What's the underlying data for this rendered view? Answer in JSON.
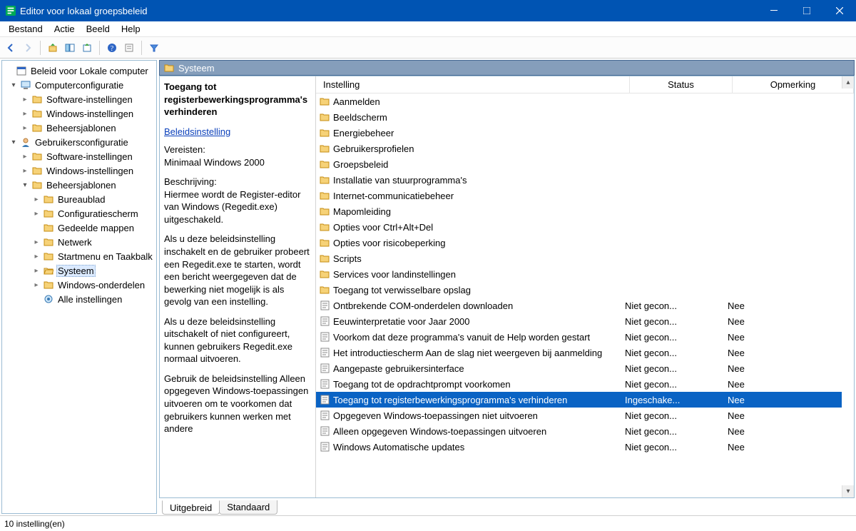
{
  "titlebar": {
    "title": "Editor voor lokaal groepsbeleid"
  },
  "menu": [
    "Bestand",
    "Actie",
    "Beeld",
    "Help"
  ],
  "node_header": "Systeem",
  "tree": {
    "root": "Beleid voor Lokale computer",
    "computer": {
      "label": "Computerconfiguratie",
      "children": [
        "Software-instellingen",
        "Windows-instellingen",
        "Beheersjablonen"
      ]
    },
    "user": {
      "label": "Gebruikersconfiguratie",
      "children": {
        "software": "Software-instellingen",
        "windows": "Windows-instellingen",
        "admin": {
          "label": "Beheersjablonen",
          "children": [
            "Bureaublad",
            "Configuratiescherm",
            "Gedeelde mappen",
            "Netwerk",
            "Startmenu en Taakbalk",
            "Systeem",
            "Windows-onderdelen",
            "Alle instellingen"
          ]
        }
      }
    }
  },
  "desc": {
    "title": "Toegang tot registerbewerkingsprogramma's verhinderen",
    "link": "Beleidsinstelling",
    "req_label": "Vereisten:",
    "req_value": "Minimaal Windows 2000",
    "body_label": "Beschrijving:",
    "body1": "Hiermee wordt de Register-editor van Windows (Regedit.exe) uitgeschakeld.",
    "body2": "Als u deze beleidsinstelling inschakelt en de gebruiker probeert een Regedit.exe te starten, wordt een bericht weergegeven dat de bewerking niet mogelijk is als gevolg van een instelling.",
    "body3": "Als u deze beleidsinstelling uitschakelt of niet configureert, kunnen gebruikers Regedit.exe normaal uitvoeren.",
    "body4": "Gebruik de beleidsinstelling Alleen opgegeven Windows-toepassingen uitvoeren om te voorkomen dat gebruikers kunnen werken met andere"
  },
  "columns": {
    "setting": "Instelling",
    "status": "Status",
    "comment": "Opmerking"
  },
  "list": {
    "folders": [
      "Aanmelden",
      "Beeldscherm",
      "Energiebeheer",
      "Gebruikersprofielen",
      "Groepsbeleid",
      "Installatie van stuurprogramma's",
      "Internet-communicatiebeheer",
      "Mapomleiding",
      "Opties voor Ctrl+Alt+Del",
      "Opties voor risicobeperking",
      "Scripts",
      "Services voor landinstellingen",
      "Toegang tot verwisselbare opslag"
    ],
    "policies": [
      {
        "name": "Ontbrekende COM-onderdelen downloaden",
        "status": "Niet gecon...",
        "comment": "Nee"
      },
      {
        "name": "Eeuwinterpretatie voor Jaar 2000",
        "status": "Niet gecon...",
        "comment": "Nee"
      },
      {
        "name": "Voorkom dat deze programma's vanuit de Help worden gestart",
        "status": "Niet gecon...",
        "comment": "Nee"
      },
      {
        "name": "Het introductiescherm Aan de slag niet weergeven bij aanmelding",
        "status": "Niet gecon...",
        "comment": "Nee"
      },
      {
        "name": "Aangepaste gebruikersinterface",
        "status": "Niet gecon...",
        "comment": "Nee"
      },
      {
        "name": "Toegang tot de opdrachtprompt voorkomen",
        "status": "Niet gecon...",
        "comment": "Nee"
      },
      {
        "name": "Toegang tot registerbewerkingsprogramma's verhinderen",
        "status": "Ingeschake...",
        "comment": "Nee",
        "selected": true
      },
      {
        "name": "Opgegeven Windows-toepassingen niet uitvoeren",
        "status": "Niet gecon...",
        "comment": "Nee"
      },
      {
        "name": "Alleen opgegeven Windows-toepassingen uitvoeren",
        "status": "Niet gecon...",
        "comment": "Nee"
      },
      {
        "name": "Windows Automatische updates",
        "status": "Niet gecon...",
        "comment": "Nee"
      }
    ]
  },
  "tabs": {
    "extended": "Uitgebreid",
    "standard": "Standaard"
  },
  "status": "10 instelling(en)"
}
